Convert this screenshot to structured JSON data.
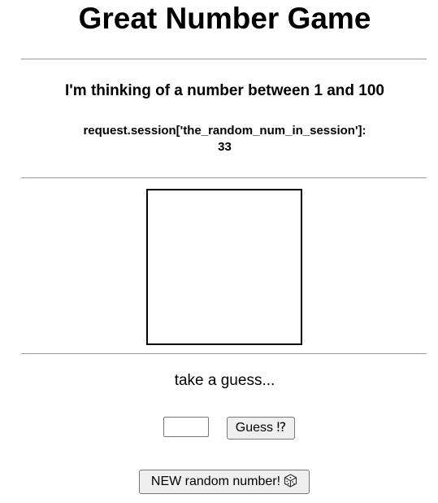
{
  "header": {
    "title": "Great Number Game"
  },
  "intro": {
    "text": "I'm thinking of a number between 1 and 100"
  },
  "session": {
    "label": "request.session['the_random_num_in_session']:",
    "value": "33"
  },
  "guess": {
    "prompt": "take a guess...",
    "input_value": "",
    "button_label": "Guess ⁉"
  },
  "reset": {
    "button_label": "NEW random number!",
    "icon": "dice-icon"
  }
}
